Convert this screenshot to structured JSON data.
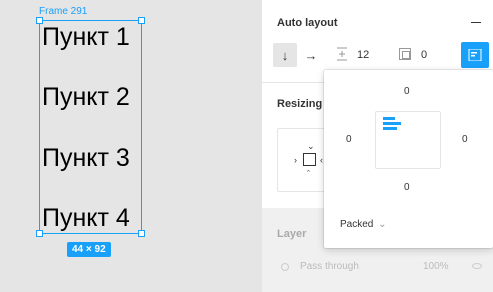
{
  "canvas": {
    "frame_name": "Frame 291",
    "items": [
      "Пункт 1",
      "Пункт 2",
      "Пункт 3",
      "Пункт 4"
    ],
    "size_label": "44 × 92"
  },
  "auto_layout": {
    "title": "Auto layout",
    "spacing_value": "12",
    "padding_value": "0"
  },
  "resizing": {
    "title": "Resizing"
  },
  "layer": {
    "title": "Layer",
    "blend_mode": "Pass through",
    "opacity": "100%"
  },
  "padding_popover": {
    "top": "0",
    "left": "0",
    "right": "0",
    "bottom": "0",
    "distribution": "Packed"
  },
  "colors": {
    "accent": "#18a0fb"
  }
}
